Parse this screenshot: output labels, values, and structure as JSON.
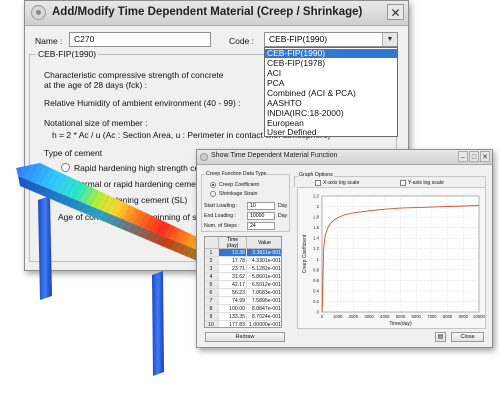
{
  "dialog_main": {
    "title": "Add/Modify Time Dependent Material (Creep / Shrinkage)",
    "name_label": "Name :",
    "name_value": "C270",
    "code_label": "Code :",
    "code_value": "CEB-FIP(1990)",
    "code_options": [
      "CEB-FIP(1990)",
      "CEB-FIP(1978)",
      "ACI",
      "PCA",
      "Combined (ACI & PCA)",
      "AASHTO",
      "INDIA(IRC:18-2000)",
      "European",
      "User Defined"
    ],
    "group_caption": "CEB-FIP(1990)",
    "strength_line1": "Characteristic compressive strength of concrete",
    "strength_line2": "at the age of 28 days (fck) :",
    "humidity_label": "Relative Humidity of ambient environment (40 - 99) :",
    "notional_label": "Notational size of member :",
    "formula": "h = 2 * Ac / u  (Ac : Section Area, u : Perimeter in contact with atmosphere)",
    "cement_label": "Type of cement",
    "cement_options": [
      "Rapid hardening high strength cement",
      "Normal or rapid hardening cement (N, R)",
      "Slowly hardening cement (SL)"
    ],
    "age_label": "Age of concrete at the beginning of shrinkage"
  },
  "dialog_func": {
    "title": "Show Time Dependent Material Function",
    "data_type_caption": "Creep Function Data Type",
    "data_types": [
      "Creep Coefficient",
      "Shrinkage Strain"
    ],
    "start_loading_label": "Start Loading :",
    "start_loading_value": "10",
    "end_loading_label": "End Loading :",
    "end_loading_value": "10000",
    "steps_label": "Num. of Steps :",
    "steps_value": "24",
    "unit_day": "Day",
    "graph_options_caption": "Graph Options",
    "x_log": "X-axis log scale",
    "y_log": "Y-axis log scale",
    "table": {
      "headers": [
        "Time\n(day)",
        "Value"
      ],
      "rows": [
        [
          "1",
          "13.36",
          "3.3611e-001"
        ],
        [
          "2",
          "17.78",
          "4.3301e-001"
        ],
        [
          "3",
          "23.71",
          "5.1282e-001"
        ],
        [
          "4",
          "31.62",
          "5.8601e-001"
        ],
        [
          "5",
          "42.17",
          "6.5012e-001"
        ],
        [
          "6",
          "56.23",
          "7.0683e-001"
        ],
        [
          "7",
          "74.99",
          "7.5896e-001"
        ],
        [
          "8",
          "100.00",
          "8.0847e-001"
        ],
        [
          "9",
          "133.35",
          "8.7024e-001"
        ],
        [
          "10",
          "177.83",
          "1.00000e-001"
        ]
      ]
    },
    "redraw": "Redraw",
    "close": "Close",
    "copy_icon": "clipboard-icon"
  },
  "chart_data": {
    "type": "line",
    "title": "",
    "xlabel": "Time(day)",
    "ylabel": "Creep Coefficient",
    "xlim": [
      0,
      10000
    ],
    "ylim": [
      0,
      2.2
    ],
    "xticks": [
      0,
      1000,
      2000,
      3000,
      4000,
      5000,
      6000,
      7000,
      8000,
      9000,
      10000
    ],
    "yticks": [
      0,
      0.2,
      0.4,
      0.6,
      0.8,
      1,
      1.2,
      1.4,
      1.6,
      1.8,
      2,
      2.2
    ],
    "x": [
      10,
      100,
      200,
      400,
      600,
      800,
      1000,
      1500,
      2000,
      3000,
      4000,
      5000,
      6000,
      7000,
      8000,
      9000,
      10000
    ],
    "y": [
      0.0,
      1.2,
      1.45,
      1.62,
      1.7,
      1.75,
      1.79,
      1.85,
      1.88,
      1.92,
      1.95,
      1.97,
      1.98,
      1.99,
      2.0,
      2.01,
      2.02
    ],
    "line_color": "#d4502d",
    "grid": true
  }
}
